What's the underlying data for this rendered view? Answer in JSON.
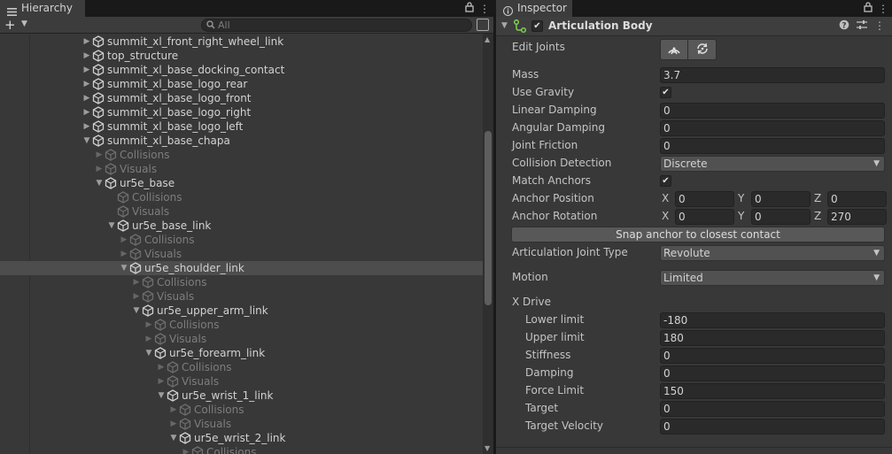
{
  "hierarchy": {
    "tab_label": "Hierarchy",
    "search_placeholder": "All",
    "add_symbol": "+",
    "rows": [
      {
        "label": "summit_xl_front_right_wheel_link",
        "expand": "collapsed",
        "dim": false,
        "selected": false
      },
      {
        "label": "top_structure",
        "expand": "collapsed",
        "dim": false,
        "selected": false
      },
      {
        "label": "summit_xl_base_docking_contact",
        "expand": "collapsed",
        "dim": false,
        "selected": false
      },
      {
        "label": "summit_xl_base_logo_rear",
        "expand": "collapsed",
        "dim": false,
        "selected": false
      },
      {
        "label": "summit_xl_base_logo_front",
        "expand": "collapsed",
        "dim": false,
        "selected": false
      },
      {
        "label": "summit_xl_base_logo_right",
        "expand": "collapsed",
        "dim": false,
        "selected": false
      },
      {
        "label": "summit_xl_base_logo_left",
        "expand": "collapsed",
        "dim": false,
        "selected": false
      },
      {
        "label": "summit_xl_base_chapa",
        "expand": "expanded",
        "dim": false,
        "selected": false
      },
      {
        "label": "Collisions",
        "expand": "collapsed",
        "dim": true,
        "selected": false
      },
      {
        "label": "Visuals",
        "expand": "collapsed",
        "dim": true,
        "selected": false
      },
      {
        "label": "ur5e_base",
        "expand": "expanded",
        "dim": false,
        "selected": false
      },
      {
        "label": "Collisions",
        "expand": "none",
        "dim": true,
        "selected": false
      },
      {
        "label": "Visuals",
        "expand": "none",
        "dim": true,
        "selected": false
      },
      {
        "label": "ur5e_base_link",
        "expand": "expanded",
        "dim": false,
        "selected": false
      },
      {
        "label": "Collisions",
        "expand": "collapsed",
        "dim": true,
        "selected": false
      },
      {
        "label": "Visuals",
        "expand": "collapsed",
        "dim": true,
        "selected": false
      },
      {
        "label": "ur5e_shoulder_link",
        "expand": "expanded",
        "dim": false,
        "selected": true
      },
      {
        "label": "Collisions",
        "expand": "collapsed",
        "dim": true,
        "selected": false
      },
      {
        "label": "Visuals",
        "expand": "collapsed",
        "dim": true,
        "selected": false
      },
      {
        "label": "ur5e_upper_arm_link",
        "expand": "expanded",
        "dim": false,
        "selected": false
      },
      {
        "label": "Collisions",
        "expand": "collapsed",
        "dim": true,
        "selected": false
      },
      {
        "label": "Visuals",
        "expand": "collapsed",
        "dim": true,
        "selected": false
      },
      {
        "label": "ur5e_forearm_link",
        "expand": "expanded",
        "dim": false,
        "selected": false
      },
      {
        "label": "Collisions",
        "expand": "collapsed",
        "dim": true,
        "selected": false
      },
      {
        "label": "Visuals",
        "expand": "collapsed",
        "dim": true,
        "selected": false
      },
      {
        "label": "ur5e_wrist_1_link",
        "expand": "expanded",
        "dim": false,
        "selected": false
      },
      {
        "label": "Collisions",
        "expand": "collapsed",
        "dim": true,
        "selected": false
      },
      {
        "label": "Visuals",
        "expand": "collapsed",
        "dim": true,
        "selected": false
      },
      {
        "label": "ur5e_wrist_2_link",
        "expand": "expanded",
        "dim": false,
        "selected": false
      },
      {
        "label": "Collisions",
        "expand": "collapsed",
        "dim": true,
        "selected": false
      }
    ]
  },
  "inspector": {
    "tab_label": "Inspector",
    "component": {
      "title": "Articulation Body",
      "enabled": true,
      "edit_joints_label": "Edit Joints",
      "mass_label": "Mass",
      "mass_value": "3.7",
      "use_gravity_label": "Use Gravity",
      "use_gravity": true,
      "linear_damping_label": "Linear Damping",
      "linear_damping_value": "0",
      "angular_damping_label": "Angular Damping",
      "angular_damping_value": "0",
      "joint_friction_label": "Joint Friction",
      "joint_friction_value": "0",
      "collision_detection_label": "Collision Detection",
      "collision_detection_value": "Discrete",
      "match_anchors_label": "Match Anchors",
      "match_anchors": true,
      "anchor_position_label": "Anchor Position",
      "anchor_position": {
        "x_label": "X",
        "x": "0",
        "y_label": "Y",
        "y": "0",
        "z_label": "Z",
        "z": "0"
      },
      "anchor_rotation_label": "Anchor Rotation",
      "anchor_rotation": {
        "x_label": "X",
        "x": "0",
        "y_label": "Y",
        "y": "0",
        "z_label": "Z",
        "z": "270"
      },
      "snap_button_label": "Snap anchor to closest contact",
      "joint_type_label": "Articulation Joint Type",
      "joint_type_value": "Revolute",
      "motion_label": "Motion",
      "motion_value": "Limited",
      "xdrive_label": "X Drive",
      "xdrive": [
        {
          "label": "Lower limit",
          "value": "-180"
        },
        {
          "label": "Upper limit",
          "value": "180"
        },
        {
          "label": "Stiffness",
          "value": "0"
        },
        {
          "label": "Damping",
          "value": "0"
        },
        {
          "label": "Force Limit",
          "value": "150"
        },
        {
          "label": "Target",
          "value": "0"
        },
        {
          "label": "Target Velocity",
          "value": "0"
        }
      ]
    }
  },
  "colors": {
    "panel_bg": "#383838",
    "selection": "#4d4d4d",
    "field_bg": "#2a2a2a",
    "dropdown_bg": "#515151",
    "accent_green": "#7fcf4f"
  },
  "icons": [
    "hamburger-icon",
    "lock-icon",
    "kebab-menu-icon",
    "search-icon",
    "gameobject-cube-icon",
    "articulation-body-icon",
    "help-icon",
    "settings-sliders-icon",
    "edit-joint-angular-icon",
    "edit-joint-rotate-icon"
  ]
}
